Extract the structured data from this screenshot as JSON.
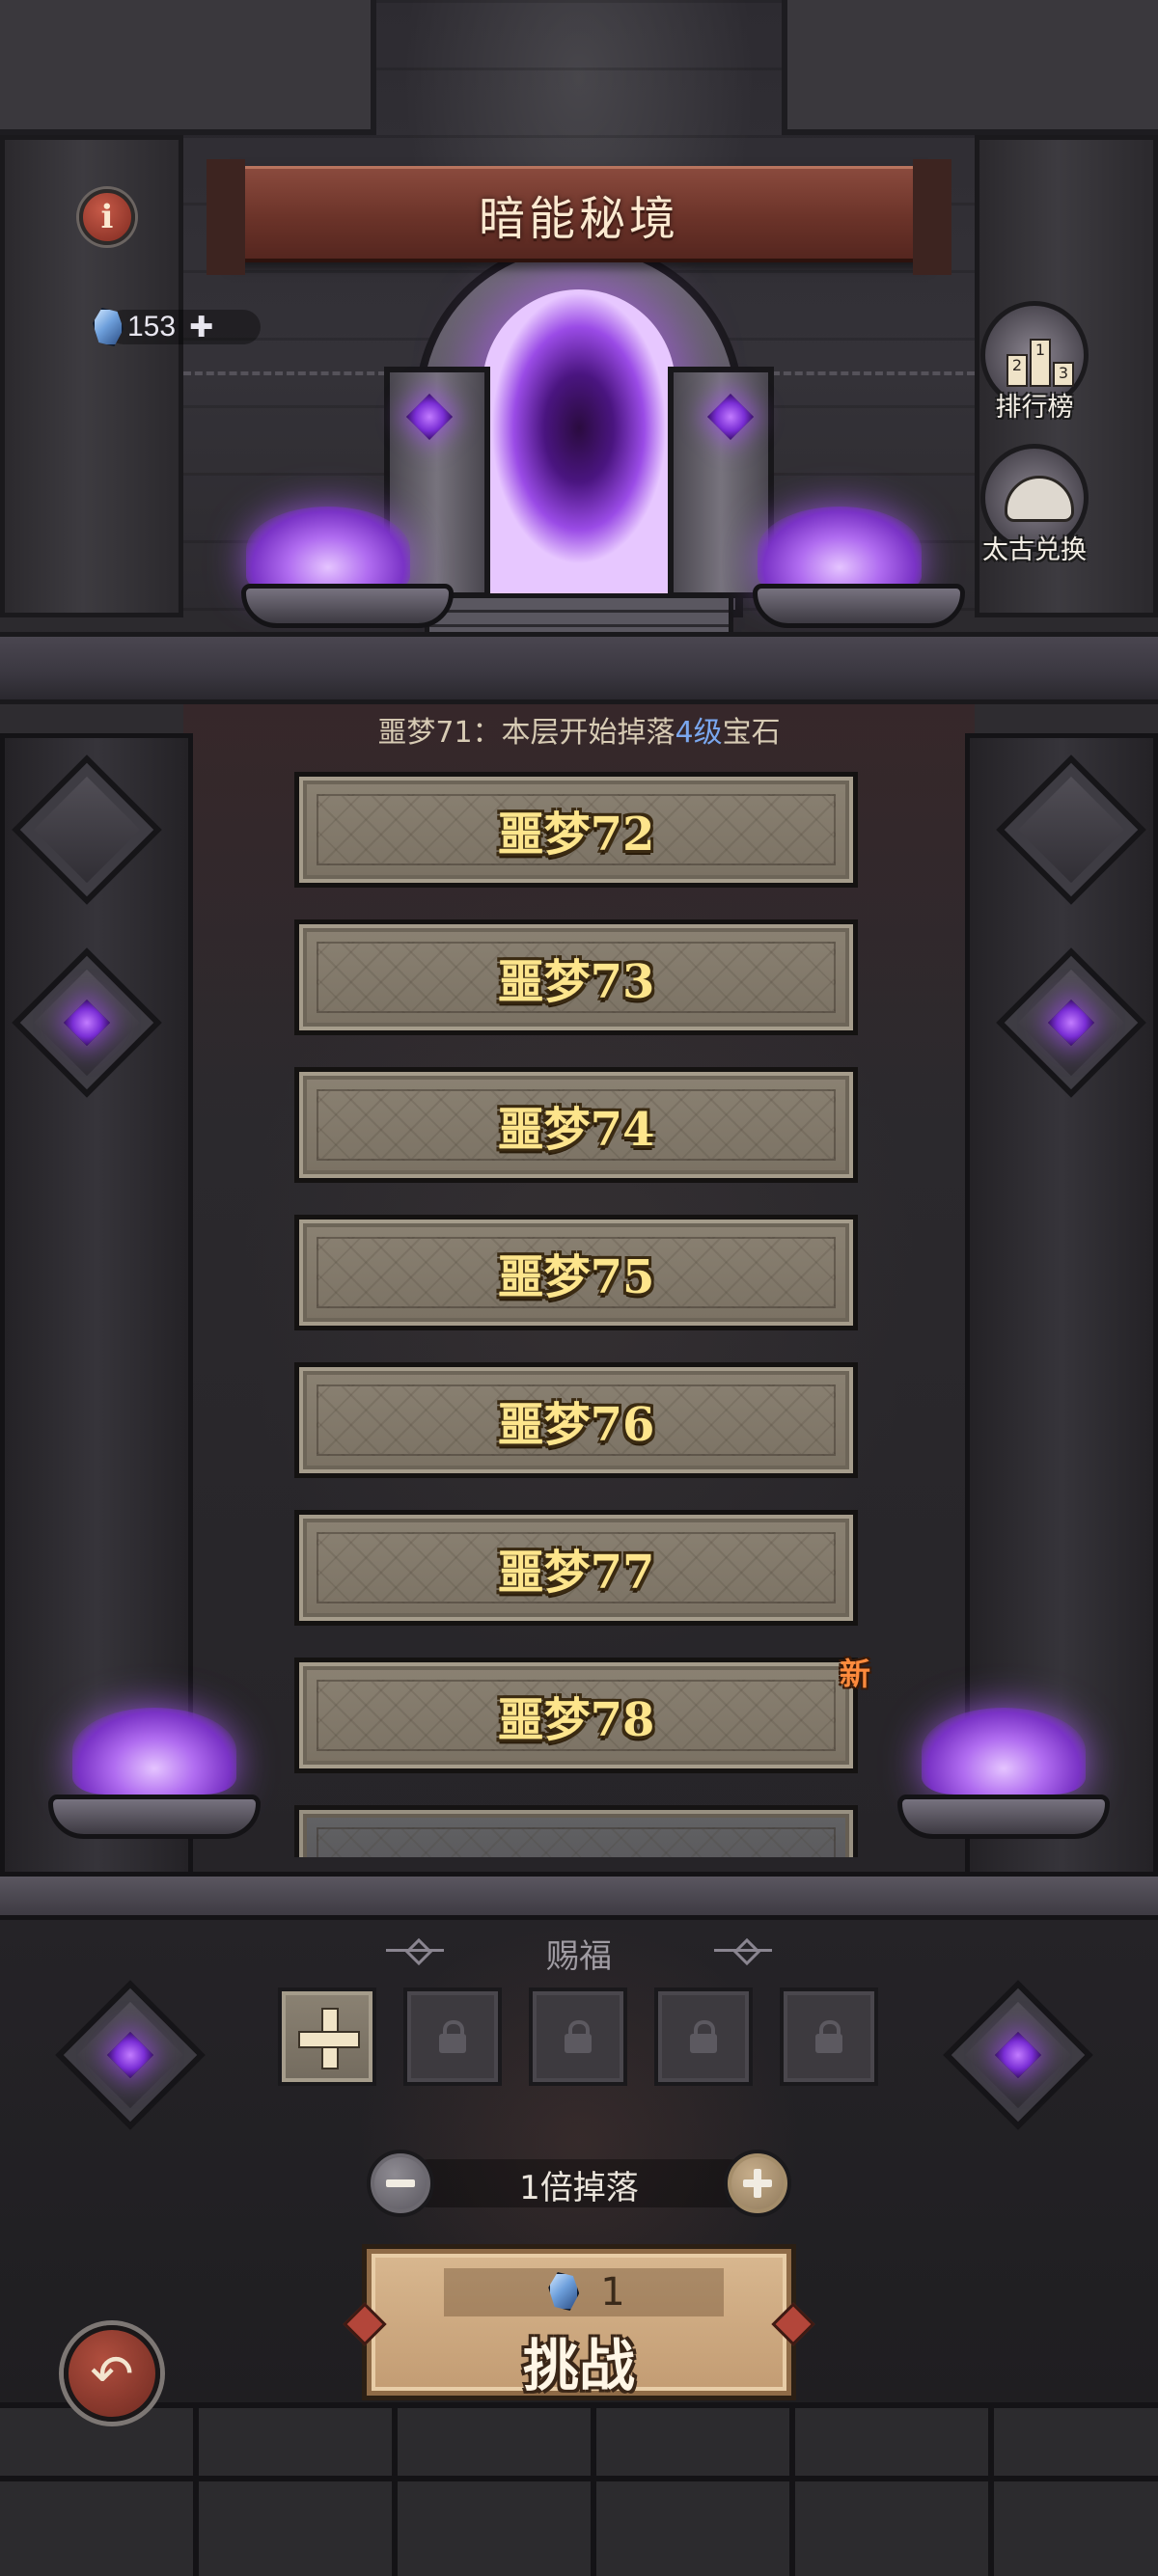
{
  "header": {
    "title": "暗能秘境"
  },
  "currency": {
    "icon": "blue-crystal-icon",
    "value": "153",
    "add_symbol": "✚"
  },
  "side_buttons": {
    "ranking_label": "排行榜",
    "exchange_label": "太古兑换"
  },
  "status": {
    "prefix": "噩梦71：本层开始掉落",
    "highlight": "4级",
    "suffix": "宝石",
    "highlight_color": "#7aa7ee"
  },
  "floors": [
    {
      "label": "噩梦72"
    },
    {
      "label": "噩梦73"
    },
    {
      "label": "噩梦74"
    },
    {
      "label": "噩梦75"
    },
    {
      "label": "噩梦76"
    },
    {
      "label": "噩梦77"
    },
    {
      "label": "噩梦78",
      "badge": "新"
    }
  ],
  "blessing": {
    "title": "赐福",
    "slots": [
      "add",
      "locked",
      "locked",
      "locked",
      "locked"
    ]
  },
  "multiplier": {
    "label": "1倍掉落"
  },
  "challenge": {
    "cost": "1",
    "label": "挑战"
  },
  "colors": {
    "accent_gold": "#fde58c",
    "portal_purple": "#9a4be6",
    "banner_red": "#6b3329"
  }
}
